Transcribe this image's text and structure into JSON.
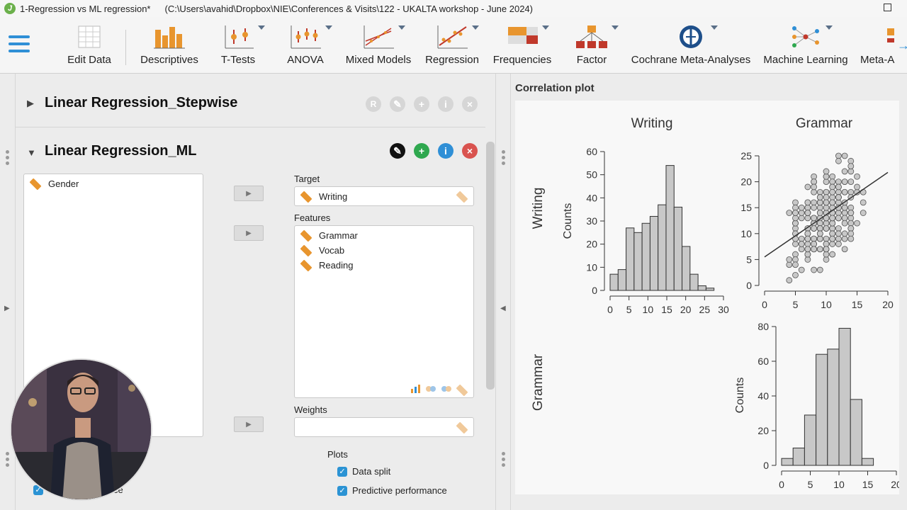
{
  "window": {
    "title": "1-Regression vs ML regression*",
    "path": "(C:\\Users\\avahid\\Dropbox\\NIE\\Conferences & Visits\\122 - UKALTA workshop - June 2024)"
  },
  "ribbon": {
    "items": [
      {
        "label": "Edit Data",
        "icon": "spreadsheet-icon"
      },
      {
        "label": "Descriptives",
        "icon": "bar-chart-icon"
      },
      {
        "label": "T-Tests",
        "icon": "ttest-icon"
      },
      {
        "label": "ANOVA",
        "icon": "anova-icon"
      },
      {
        "label": "Mixed Models",
        "icon": "mixed-models-icon"
      },
      {
        "label": "Regression",
        "icon": "regression-icon"
      },
      {
        "label": "Frequencies",
        "icon": "frequencies-icon"
      },
      {
        "label": "Factor",
        "icon": "factor-icon"
      },
      {
        "label": "Cochrane Meta-Analyses",
        "icon": "cochrane-icon"
      },
      {
        "label": "Machine Learning",
        "icon": "machine-learning-icon"
      },
      {
        "label": "Meta-A",
        "icon": "meta-analysis-icon"
      }
    ]
  },
  "analyses": {
    "stepwise": {
      "title": "Linear Regression_Stepwise",
      "buttons": [
        "R",
        "✎",
        "+",
        "i",
        "×"
      ]
    },
    "ml": {
      "title": "Linear Regression_ML"
    }
  },
  "form": {
    "available_vars": [
      "Gender"
    ],
    "target_label": "Target",
    "target": "Writing",
    "features_label": "Features",
    "features": [
      "Grammar",
      "Vocab",
      "Reading"
    ],
    "weights_label": "Weights",
    "plots_label": "Plots",
    "checkboxes": [
      {
        "label": "Data split",
        "checked": true
      },
      {
        "label": "Predictive performance",
        "checked": true
      }
    ],
    "partial_left_checkbox_label": "ce"
  },
  "output": {
    "plot_title": "Correlation plot",
    "col_titles": [
      "Writing",
      "Grammar"
    ],
    "row_titles": [
      "Writing",
      "Grammar"
    ],
    "counts_label": "Counts"
  },
  "chart_data": [
    {
      "type": "bar",
      "title": "Writing",
      "ylabel": "Counts",
      "bin_edges": [
        0,
        2.5,
        5,
        7.5,
        10,
        12.5,
        15,
        17.5,
        20,
        22.5,
        25,
        27.5
      ],
      "values": [
        7,
        9,
        27,
        25,
        29,
        32,
        37,
        54,
        36,
        19,
        7,
        2,
        1
      ],
      "x_ticks": [
        0,
        5,
        10,
        15,
        20,
        25,
        30
      ],
      "y_ticks": [
        0,
        10,
        20,
        30,
        40,
        50,
        60
      ],
      "xlim": [
        0,
        30
      ],
      "ylim": [
        0,
        60
      ]
    },
    {
      "type": "scatter",
      "x_ticks": [
        0,
        5,
        10,
        15,
        20
      ],
      "y_ticks": [
        0,
        5,
        10,
        15,
        20,
        25
      ],
      "xlim": [
        0,
        20
      ],
      "ylim": [
        0,
        25
      ],
      "fit_line": {
        "x": [
          0,
          20
        ],
        "y": [
          5.5,
          21.8
        ]
      }
    },
    {
      "type": "bar",
      "title": "Grammar",
      "ylabel": "Counts",
      "values": [
        4,
        10,
        29,
        64,
        67,
        79,
        38,
        4
      ],
      "x_ticks": [
        0,
        5,
        10,
        15,
        20
      ],
      "y_ticks": [
        0,
        20,
        40,
        60,
        80
      ],
      "xlim": [
        0,
        20
      ],
      "ylim": [
        0,
        80
      ]
    }
  ],
  "colors": {
    "accent": "#2f8fd6",
    "bar_fill": "#c8c8c8",
    "green_button": "#2fa84f",
    "blue_button": "#2f8fd6",
    "red_button": "#d9534f"
  }
}
